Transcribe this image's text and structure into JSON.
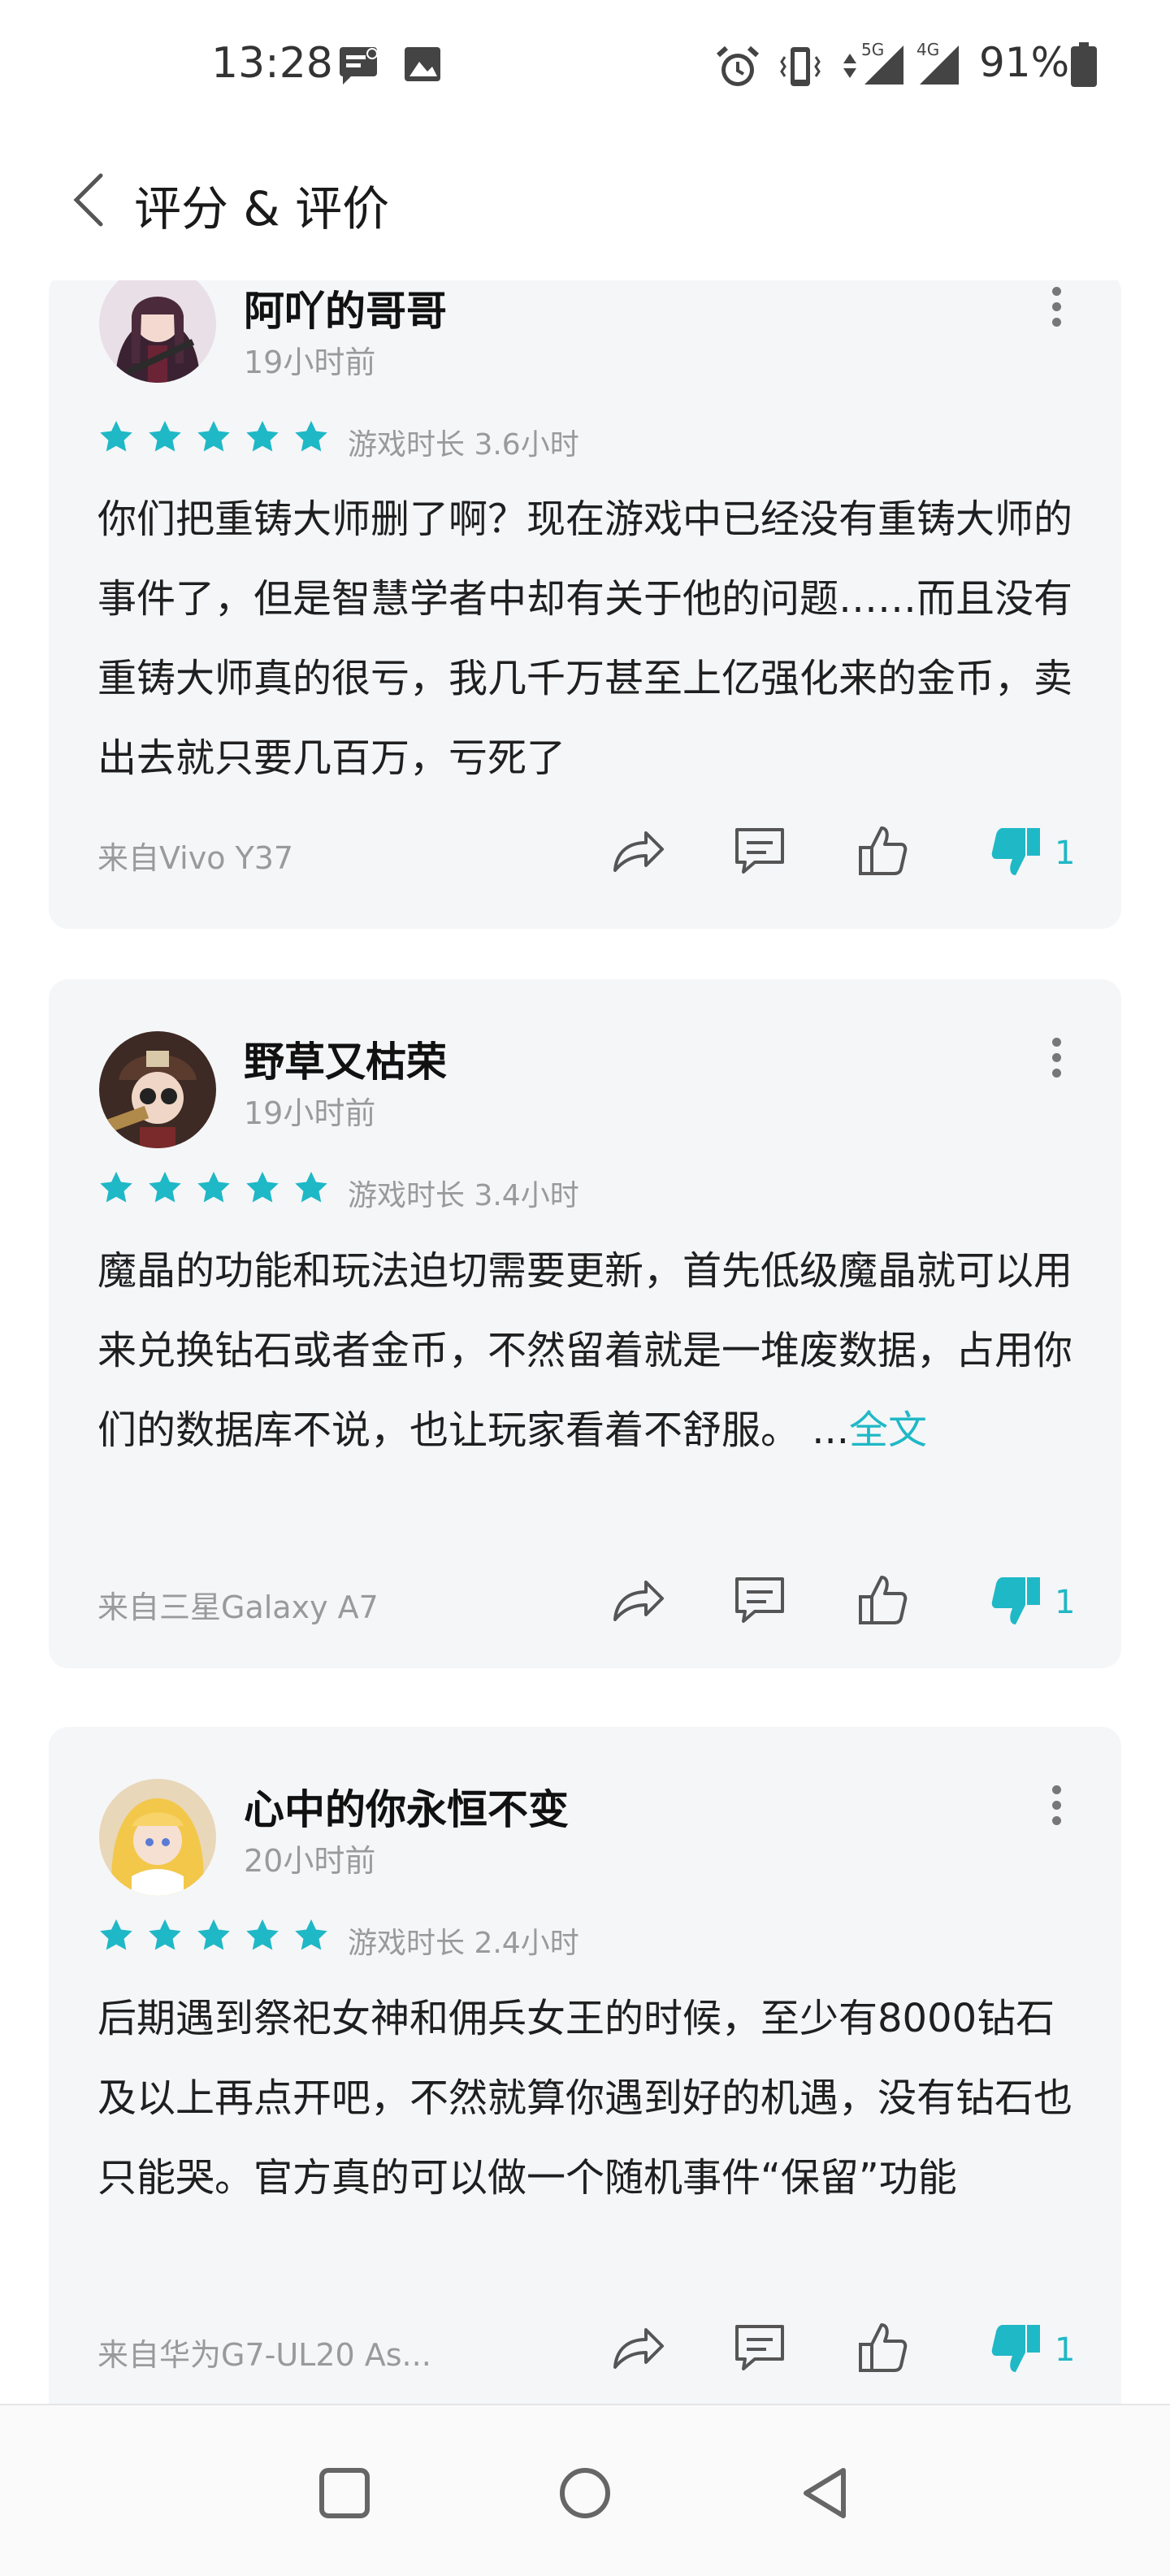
{
  "status_bar": {
    "time": "13:28",
    "battery_percent": "91%",
    "network_labels": [
      "5G",
      "4G"
    ],
    "icons": [
      "message-notification-icon",
      "image-notification-icon",
      "alarm-icon",
      "vibrate-icon",
      "data-arrows-icon",
      "signal-5g-icon",
      "signal-4g-icon",
      "battery-icon"
    ]
  },
  "header": {
    "title": "评分 & 评价",
    "back_icon": "chevron-left-icon"
  },
  "colors": {
    "accent": "#1fb8c6",
    "card_background": "#f5f6f8",
    "secondary_text": "#9a9a9a"
  },
  "reviews": [
    {
      "username": "阿吖的哥哥",
      "time": "19小时前",
      "rating": 5,
      "play_time": "游戏时长 3.6小时",
      "text": "你们把重铸大师删了啊？现在游戏中已经没有重铸大师的事件了，但是智慧学者中却有关于他的问题……而且没有重铸大师真的很亏，我几千万甚至上亿强化来的金币，卖出去就只要几百万，亏死了",
      "full_text_link": "",
      "device": "来自Vivo Y37",
      "dislike_count": "1"
    },
    {
      "username": "野草又枯荣",
      "time": "19小时前",
      "rating": 5,
      "play_time": "游戏时长 3.4小时",
      "text": "魔晶的功能和玩法迫切需要更新，首先低级魔晶就可以用来兑换钻石或者金币，不然留着就是一堆废数据，占用你们的数据库不说，也让玩家看着不舒服。 ...",
      "full_text_link": "全文",
      "device": "来自三星Galaxy A7",
      "dislike_count": "1"
    },
    {
      "username": "心中的你永恒不变",
      "time": "20小时前",
      "rating": 5,
      "play_time": "游戏时长 2.4小时",
      "text": "后期遇到祭祀女神和佣兵女王的时候，至少有8000钻石及以上再点开吧，不然就算你遇到好的机遇，没有钻石也只能哭。官方真的可以做一个随机事件“保留”功能",
      "full_text_link": "",
      "device": "来自华为G7-UL20 As...",
      "dislike_count": "1"
    }
  ],
  "actions": [
    "share-icon",
    "comment-icon",
    "thumbs-up-icon",
    "thumbs-down-icon"
  ],
  "nav_bar": [
    "recents-square-icon",
    "home-circle-icon",
    "back-triangle-icon"
  ]
}
